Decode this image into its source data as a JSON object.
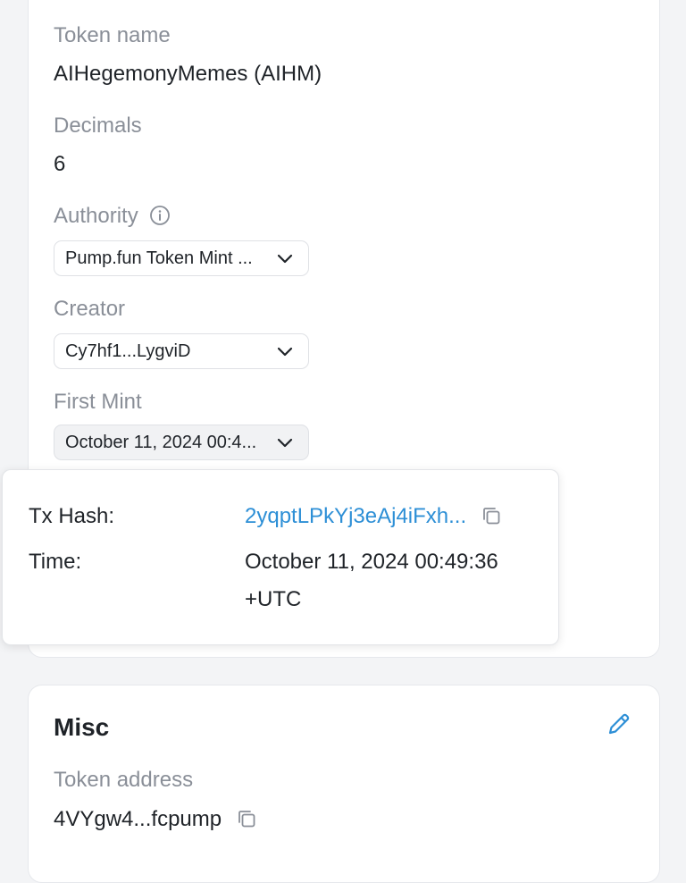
{
  "overview": {
    "token_name_label": "Token name",
    "token_name_value": "AIHegemonyMemes (AIHM)",
    "decimals_label": "Decimals",
    "decimals_value": "6",
    "authority_label": "Authority",
    "authority_value": "Pump.fun Token Mint ...",
    "creator_label": "Creator",
    "creator_value": "Cy7hf1...LygviD",
    "first_mint_label": "First Mint",
    "first_mint_value": "October 11, 2024 00:4..."
  },
  "popover": {
    "tx_hash_label": "Tx Hash:",
    "tx_hash_value": "2yqptLPkYj3eAj4iFxh...",
    "time_label": "Time:",
    "time_value_line1": "October 11, 2024 00:49:36",
    "time_value_line2": "+UTC"
  },
  "misc": {
    "title": "Misc",
    "token_address_label": "Token address",
    "token_address_value": "4VYgw4...fcpump"
  },
  "colors": {
    "accent": "#2d8fd6",
    "label_gray": "#8a8f98",
    "text": "#1f2328",
    "page_bg": "#f3f4f6"
  },
  "icons": [
    "info-icon",
    "chevron-down-icon",
    "copy-icon",
    "pencil-icon"
  ]
}
